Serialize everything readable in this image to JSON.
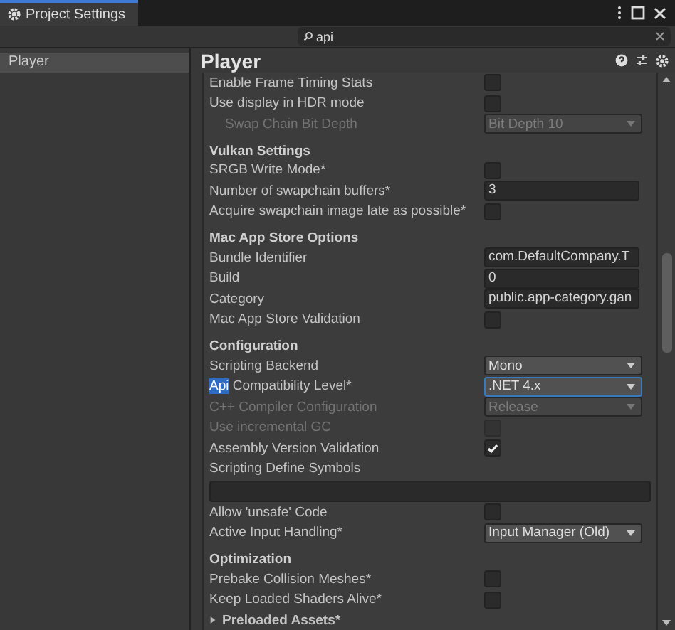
{
  "window": {
    "title": "Project Settings"
  },
  "search": {
    "value": "api"
  },
  "sidebar": {
    "items": [
      {
        "label": "Player",
        "selected": true
      }
    ]
  },
  "panel": {
    "title": "Player",
    "rows": [
      {
        "kind": "checkbox",
        "label": "Enable Frame Timing Stats",
        "checked": false,
        "disabled": false
      },
      {
        "kind": "checkbox",
        "label": "Use display in HDR mode",
        "checked": false,
        "disabled": false
      },
      {
        "kind": "dropdown",
        "label": "Swap Chain Bit Depth",
        "value": "Bit Depth 10",
        "disabled": true,
        "indented": true
      },
      {
        "kind": "header",
        "label": "Vulkan Settings"
      },
      {
        "kind": "checkbox",
        "label": "SRGB Write Mode*",
        "checked": false,
        "disabled": false
      },
      {
        "kind": "text",
        "label": "Number of swapchain buffers*",
        "value": "3"
      },
      {
        "kind": "checkbox",
        "label": "Acquire swapchain image late as possible*",
        "checked": false,
        "disabled": false
      },
      {
        "kind": "header",
        "label": "Mac App Store Options"
      },
      {
        "kind": "text",
        "label": "Bundle Identifier",
        "value": "com.DefaultCompany.T"
      },
      {
        "kind": "text",
        "label": "Build",
        "value": "0"
      },
      {
        "kind": "text",
        "label": "Category",
        "value": "public.app-category.gan"
      },
      {
        "kind": "checkbox",
        "label": "Mac App Store Validation",
        "checked": false,
        "disabled": false
      },
      {
        "kind": "header",
        "label": "Configuration"
      },
      {
        "kind": "dropdown",
        "label": "Scripting Backend",
        "value": "Mono",
        "disabled": false
      },
      {
        "kind": "dropdown",
        "match": "Api",
        "label": " Compatibility Level*",
        "value": ".NET 4.x",
        "disabled": false,
        "focused": true
      },
      {
        "kind": "dropdown",
        "label": "C++ Compiler Configuration",
        "value": "Release",
        "disabled": true
      },
      {
        "kind": "checkbox",
        "label": "Use incremental GC",
        "checked": false,
        "disabled": true
      },
      {
        "kind": "checkbox",
        "label": "Assembly Version Validation",
        "checked": true,
        "disabled": false
      },
      {
        "kind": "label",
        "label": "Scripting Define Symbols"
      },
      {
        "kind": "wide_text"
      },
      {
        "kind": "checkbox",
        "label": "Allow 'unsafe' Code",
        "checked": false,
        "disabled": false
      },
      {
        "kind": "dropdown",
        "label": "Active Input Handling*",
        "value": "Input Manager (Old)",
        "disabled": false
      },
      {
        "kind": "header",
        "label": "Optimization"
      },
      {
        "kind": "checkbox",
        "label": "Prebake Collision Meshes*",
        "checked": false,
        "disabled": false
      },
      {
        "kind": "checkbox",
        "label": "Keep Loaded Shaders Alive*",
        "checked": false,
        "disabled": false
      },
      {
        "kind": "foldout",
        "label": "Preloaded Assets*",
        "expanded": false
      }
    ]
  }
}
